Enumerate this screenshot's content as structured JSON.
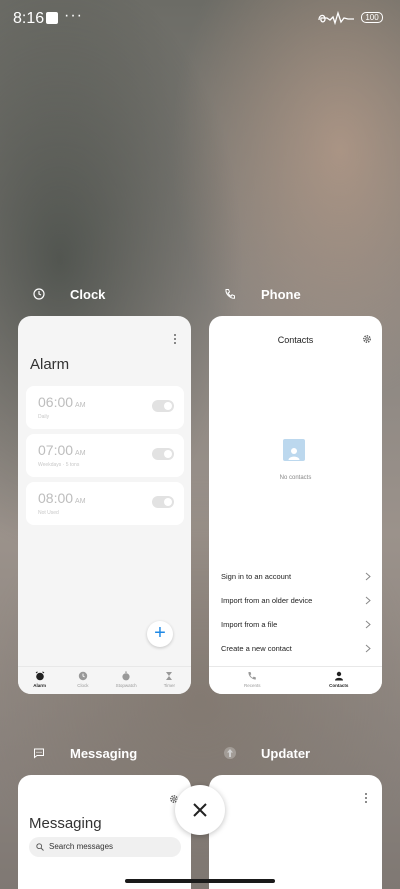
{
  "status": {
    "time": "8:16",
    "more": "···",
    "battery": "100"
  },
  "apps": {
    "clock": {
      "label": "Clock"
    },
    "phone": {
      "label": "Phone"
    },
    "messaging": {
      "label": "Messaging"
    },
    "updater": {
      "label": "Updater"
    }
  },
  "clock_card": {
    "title": "Alarm",
    "alarms": [
      {
        "time": "06:00",
        "ampm": "AM",
        "sub": "Daily"
      },
      {
        "time": "07:00",
        "ampm": "AM",
        "sub": "Weekdays · 5 tons"
      },
      {
        "time": "08:00",
        "ampm": "AM",
        "sub": "Not Used"
      }
    ],
    "fab": "+",
    "nav": [
      "Alarm",
      "Clock",
      "Stopwatch",
      "Timer"
    ]
  },
  "phone_card": {
    "title": "Contacts",
    "empty": "No contacts",
    "options": [
      "Sign in to an account",
      "Import from an older device",
      "Import from a file",
      "Create a new contact"
    ],
    "nav": [
      "Recents",
      "Contacts"
    ]
  },
  "messaging_card": {
    "title": "Messaging",
    "search_placeholder": "Search messages"
  },
  "icons": {
    "clock": "clock-icon",
    "phone": "phone-icon",
    "messaging": "chat-icon",
    "updater": "upload-icon",
    "close": "close-icon"
  },
  "colors": {
    "accent": "#1e88e5",
    "avatar": "#bcd8ee"
  }
}
